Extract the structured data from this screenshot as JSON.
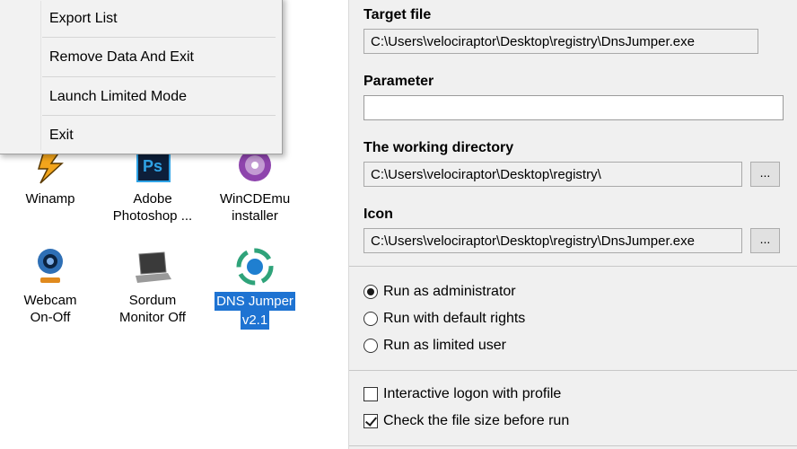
{
  "context_menu": {
    "items": [
      {
        "label": "Export List"
      },
      {
        "label": "Remove Data And Exit"
      },
      {
        "label": "Launch Limited Mode"
      },
      {
        "label": "Exit"
      }
    ]
  },
  "desktop": {
    "apps": [
      {
        "label_line1": "Winamp",
        "label_line2": "",
        "icon": "winamp-icon"
      },
      {
        "label_line1": "Adobe",
        "label_line2": "Photoshop ...",
        "icon": "photoshop-icon"
      },
      {
        "label_line1": "WinCDEmu",
        "label_line2": "installer",
        "icon": "wincdemu-icon"
      },
      {
        "label_line1": "Webcam",
        "label_line2": "On-Off",
        "icon": "webcam-icon"
      },
      {
        "label_line1": "Sordum",
        "label_line2": "Monitor Off",
        "icon": "laptop-icon"
      },
      {
        "label_line1": "DNS Jumper",
        "label_line2": "v2.1",
        "icon": "dns-jumper-icon",
        "selected": true
      }
    ]
  },
  "settings": {
    "target_file": {
      "label": "Target file",
      "value": "C:\\Users\\velociraptor\\Desktop\\registry\\DnsJumper.exe"
    },
    "parameter": {
      "label": "Parameter",
      "value": ""
    },
    "working_dir": {
      "label": "The working directory",
      "value": "C:\\Users\\velociraptor\\Desktop\\registry\\",
      "browse": "..."
    },
    "icon": {
      "label": "Icon",
      "value": "C:\\Users\\velociraptor\\Desktop\\registry\\DnsJumper.exe",
      "browse": "..."
    },
    "run_options": [
      {
        "label": "Run as administrator",
        "selected": true
      },
      {
        "label": "Run with default rights",
        "selected": false
      },
      {
        "label": "Run as limited user",
        "selected": false
      }
    ],
    "checkboxes": [
      {
        "label": "Interactive logon with profile",
        "checked": false
      },
      {
        "label": "Check the file size before run",
        "checked": true
      }
    ]
  }
}
